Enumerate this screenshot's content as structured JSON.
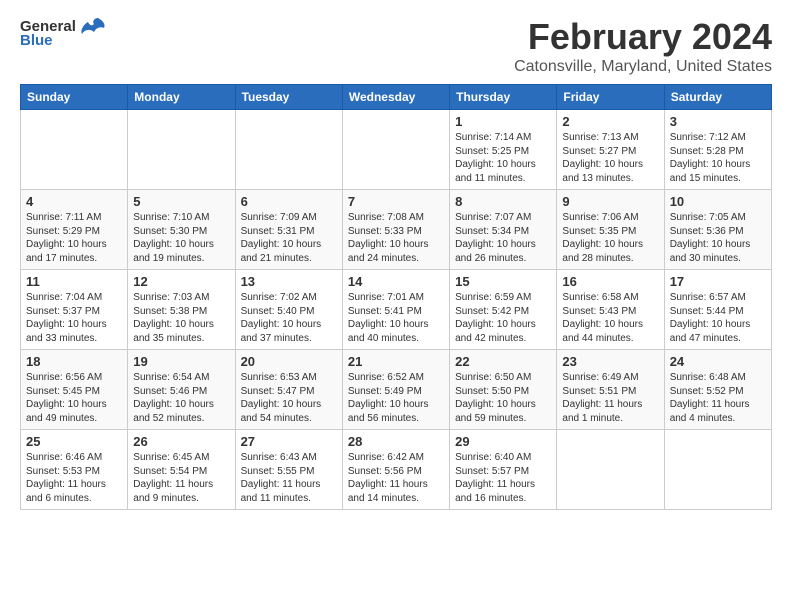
{
  "logo": {
    "text1": "General",
    "text2": "Blue"
  },
  "title": "February 2024",
  "subtitle": "Catonsville, Maryland, United States",
  "days_of_week": [
    "Sunday",
    "Monday",
    "Tuesday",
    "Wednesday",
    "Thursday",
    "Friday",
    "Saturday"
  ],
  "weeks": [
    [
      {
        "day": "",
        "info": ""
      },
      {
        "day": "",
        "info": ""
      },
      {
        "day": "",
        "info": ""
      },
      {
        "day": "",
        "info": ""
      },
      {
        "day": "1",
        "info": "Sunrise: 7:14 AM\nSunset: 5:25 PM\nDaylight: 10 hours\nand 11 minutes."
      },
      {
        "day": "2",
        "info": "Sunrise: 7:13 AM\nSunset: 5:27 PM\nDaylight: 10 hours\nand 13 minutes."
      },
      {
        "day": "3",
        "info": "Sunrise: 7:12 AM\nSunset: 5:28 PM\nDaylight: 10 hours\nand 15 minutes."
      }
    ],
    [
      {
        "day": "4",
        "info": "Sunrise: 7:11 AM\nSunset: 5:29 PM\nDaylight: 10 hours\nand 17 minutes."
      },
      {
        "day": "5",
        "info": "Sunrise: 7:10 AM\nSunset: 5:30 PM\nDaylight: 10 hours\nand 19 minutes."
      },
      {
        "day": "6",
        "info": "Sunrise: 7:09 AM\nSunset: 5:31 PM\nDaylight: 10 hours\nand 21 minutes."
      },
      {
        "day": "7",
        "info": "Sunrise: 7:08 AM\nSunset: 5:33 PM\nDaylight: 10 hours\nand 24 minutes."
      },
      {
        "day": "8",
        "info": "Sunrise: 7:07 AM\nSunset: 5:34 PM\nDaylight: 10 hours\nand 26 minutes."
      },
      {
        "day": "9",
        "info": "Sunrise: 7:06 AM\nSunset: 5:35 PM\nDaylight: 10 hours\nand 28 minutes."
      },
      {
        "day": "10",
        "info": "Sunrise: 7:05 AM\nSunset: 5:36 PM\nDaylight: 10 hours\nand 30 minutes."
      }
    ],
    [
      {
        "day": "11",
        "info": "Sunrise: 7:04 AM\nSunset: 5:37 PM\nDaylight: 10 hours\nand 33 minutes."
      },
      {
        "day": "12",
        "info": "Sunrise: 7:03 AM\nSunset: 5:38 PM\nDaylight: 10 hours\nand 35 minutes."
      },
      {
        "day": "13",
        "info": "Sunrise: 7:02 AM\nSunset: 5:40 PM\nDaylight: 10 hours\nand 37 minutes."
      },
      {
        "day": "14",
        "info": "Sunrise: 7:01 AM\nSunset: 5:41 PM\nDaylight: 10 hours\nand 40 minutes."
      },
      {
        "day": "15",
        "info": "Sunrise: 6:59 AM\nSunset: 5:42 PM\nDaylight: 10 hours\nand 42 minutes."
      },
      {
        "day": "16",
        "info": "Sunrise: 6:58 AM\nSunset: 5:43 PM\nDaylight: 10 hours\nand 44 minutes."
      },
      {
        "day": "17",
        "info": "Sunrise: 6:57 AM\nSunset: 5:44 PM\nDaylight: 10 hours\nand 47 minutes."
      }
    ],
    [
      {
        "day": "18",
        "info": "Sunrise: 6:56 AM\nSunset: 5:45 PM\nDaylight: 10 hours\nand 49 minutes."
      },
      {
        "day": "19",
        "info": "Sunrise: 6:54 AM\nSunset: 5:46 PM\nDaylight: 10 hours\nand 52 minutes."
      },
      {
        "day": "20",
        "info": "Sunrise: 6:53 AM\nSunset: 5:47 PM\nDaylight: 10 hours\nand 54 minutes."
      },
      {
        "day": "21",
        "info": "Sunrise: 6:52 AM\nSunset: 5:49 PM\nDaylight: 10 hours\nand 56 minutes."
      },
      {
        "day": "22",
        "info": "Sunrise: 6:50 AM\nSunset: 5:50 PM\nDaylight: 10 hours\nand 59 minutes."
      },
      {
        "day": "23",
        "info": "Sunrise: 6:49 AM\nSunset: 5:51 PM\nDaylight: 11 hours\nand 1 minute."
      },
      {
        "day": "24",
        "info": "Sunrise: 6:48 AM\nSunset: 5:52 PM\nDaylight: 11 hours\nand 4 minutes."
      }
    ],
    [
      {
        "day": "25",
        "info": "Sunrise: 6:46 AM\nSunset: 5:53 PM\nDaylight: 11 hours\nand 6 minutes."
      },
      {
        "day": "26",
        "info": "Sunrise: 6:45 AM\nSunset: 5:54 PM\nDaylight: 11 hours\nand 9 minutes."
      },
      {
        "day": "27",
        "info": "Sunrise: 6:43 AM\nSunset: 5:55 PM\nDaylight: 11 hours\nand 11 minutes."
      },
      {
        "day": "28",
        "info": "Sunrise: 6:42 AM\nSunset: 5:56 PM\nDaylight: 11 hours\nand 14 minutes."
      },
      {
        "day": "29",
        "info": "Sunrise: 6:40 AM\nSunset: 5:57 PM\nDaylight: 11 hours\nand 16 minutes."
      },
      {
        "day": "",
        "info": ""
      },
      {
        "day": "",
        "info": ""
      }
    ]
  ]
}
